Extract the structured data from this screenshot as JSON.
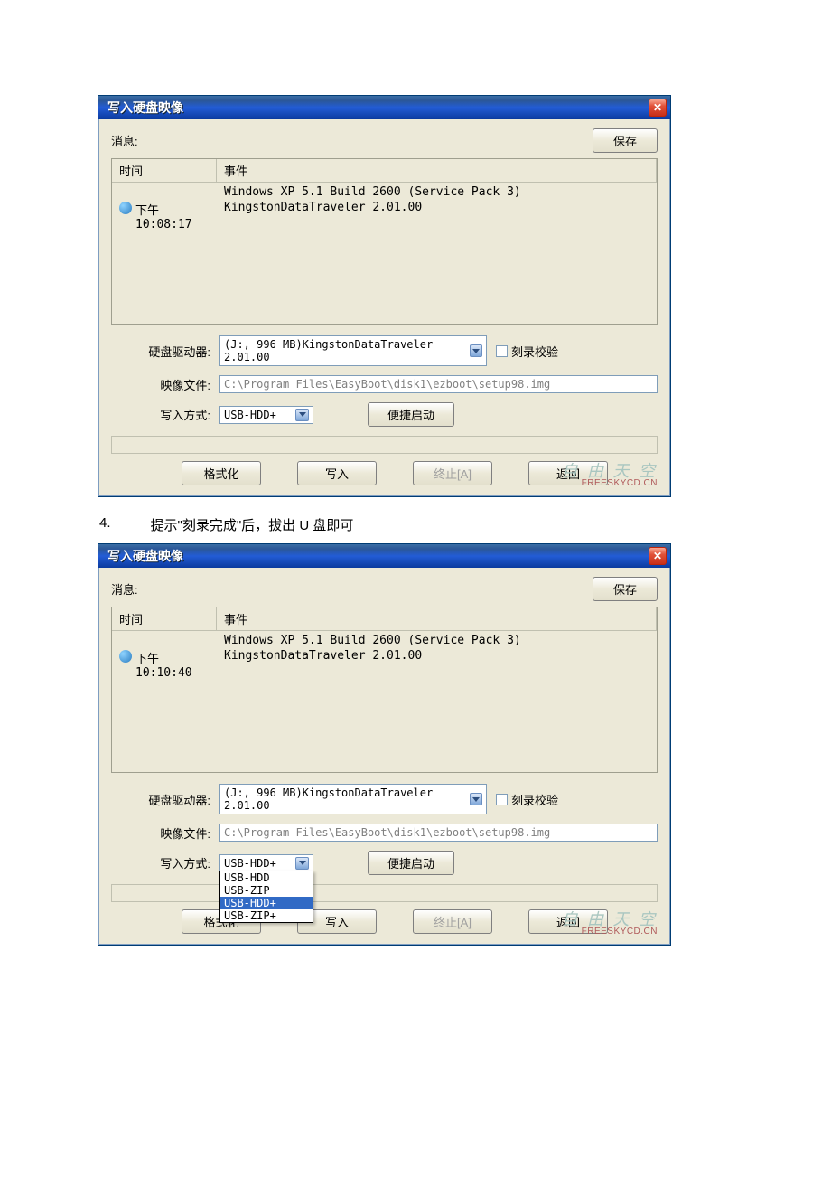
{
  "watermark": {
    "cn": "自 由 天 空",
    "en": "FREESKYCD.CN"
  },
  "step": {
    "num": "4.",
    "text": "提示\"刻录完成\"后，拔出 U 盘即可"
  },
  "d1": {
    "title": "写入硬盘映像",
    "msg_label": "消息:",
    "save_btn": "保存",
    "col_time": "时间",
    "col_event": "事件",
    "rows": [
      {
        "time": "",
        "event": "Windows XP 5.1 Build 2600 (Service Pack 3)"
      },
      {
        "time": "下午 10:08:17",
        "event": "KingstonDataTraveler 2.01.00",
        "icon": true
      }
    ],
    "f1_label": "硬盘驱动器:",
    "f1_value": "(J:, 996 MB)KingstonDataTraveler 2.01.00",
    "f1_cb": "刻录校验",
    "f2_label": "映像文件:",
    "f2_value": "C:\\Program Files\\EasyBoot\\disk1\\ezboot\\setup98.img",
    "f3_label": "写入方式:",
    "f3_value": "USB-HDD+",
    "f3_btn": "便捷启动",
    "btn_format": "格式化",
    "btn_write": "写入",
    "btn_abort": "终止[A]",
    "btn_back": "返回"
  },
  "d2": {
    "title": "写入硬盘映像",
    "msg_label": "消息:",
    "save_btn": "保存",
    "col_time": "时间",
    "col_event": "事件",
    "rows": [
      {
        "time": "",
        "event": "Windows XP 5.1 Build 2600 (Service Pack 3)"
      },
      {
        "time": "下午 10:10:40",
        "event": "KingstonDataTraveler 2.01.00",
        "icon": true
      }
    ],
    "f1_label": "硬盘驱动器:",
    "f1_value": "(J:, 996 MB)KingstonDataTraveler 2.01.00",
    "f1_cb": "刻录校验",
    "f2_label": "映像文件:",
    "f2_value": "C:\\Program Files\\EasyBoot\\disk1\\ezboot\\setup98.img",
    "f3_label": "写入方式:",
    "f3_value": "USB-HDD+",
    "f3_btn": "便捷启动",
    "dropdown": {
      "options": [
        "USB-HDD",
        "USB-ZIP",
        "USB-HDD+",
        "USB-ZIP+"
      ],
      "selected": 2
    },
    "btn_format": "格式化",
    "btn_write": "写入",
    "btn_abort": "终止[A]",
    "btn_back": "返回"
  }
}
